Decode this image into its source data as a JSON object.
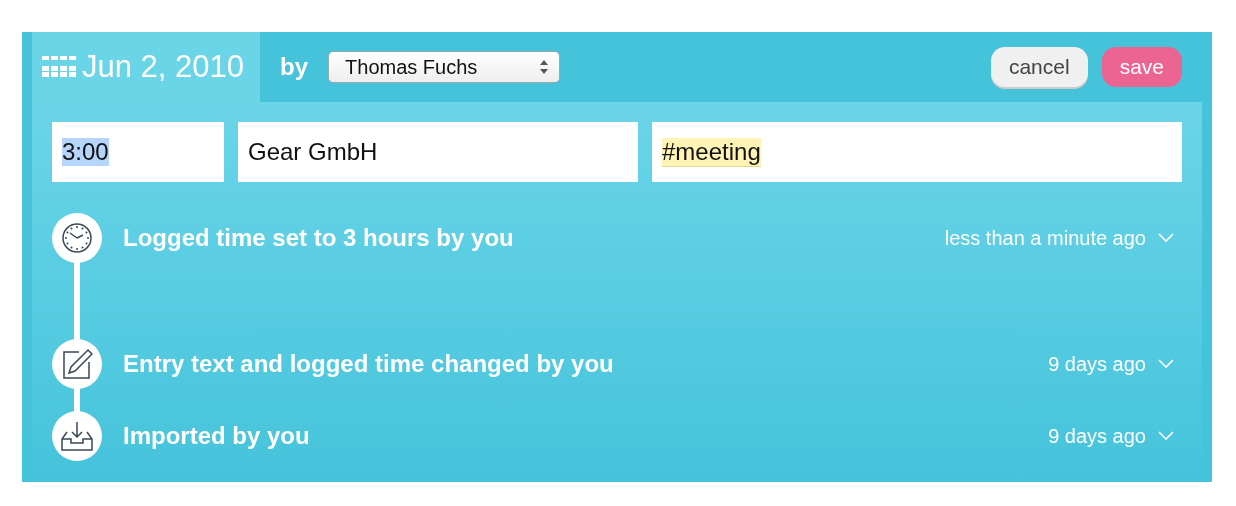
{
  "header": {
    "date": "Jun 2, 2010",
    "by_label": "by",
    "user_select": {
      "value": "Thomas Fuchs"
    },
    "buttons": [
      {
        "label": "cancel",
        "kind": "secondary"
      },
      {
        "label": "save",
        "kind": "primary"
      }
    ]
  },
  "fields": [
    {
      "value": "3:00",
      "text_selected": true,
      "tag_highlight": false
    },
    {
      "value": "Gear GmbH",
      "text_selected": false,
      "tag_highlight": false
    },
    {
      "value": "#meeting",
      "text_selected": false,
      "tag_highlight": true
    }
  ],
  "timeline": [
    {
      "kind": "clock",
      "text": "Logged time set to 3 hours by you",
      "time": "less than a minute ago"
    },
    {
      "kind": "pencil",
      "text": "Entry text and logged time changed by you",
      "time": "9 days ago"
    },
    {
      "kind": "inbox",
      "text": "Imported by you",
      "time": "9 days ago"
    }
  ]
}
